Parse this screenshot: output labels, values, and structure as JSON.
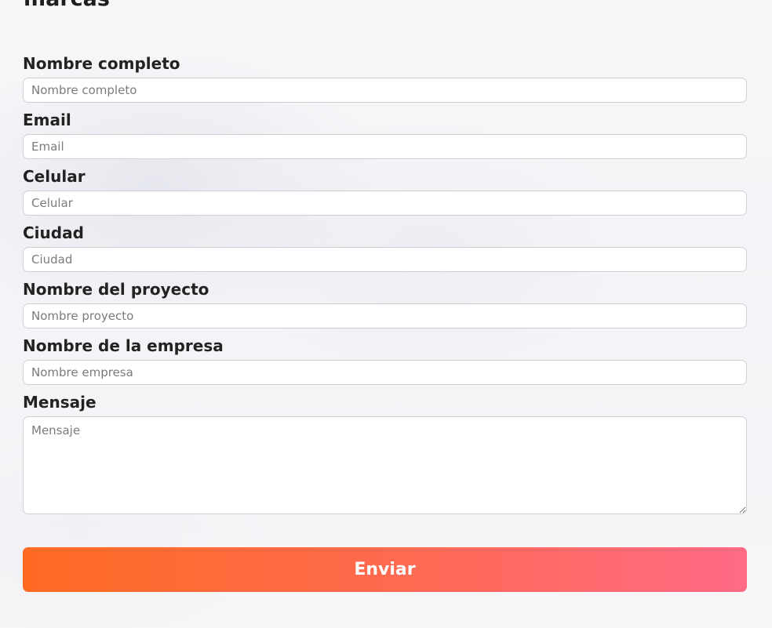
{
  "form": {
    "heading": "marcas",
    "fields": [
      {
        "label": "Nombre completo",
        "placeholder": "Nombre completo",
        "value": ""
      },
      {
        "label": "Email",
        "placeholder": "Email",
        "value": ""
      },
      {
        "label": "Celular",
        "placeholder": "Celular",
        "value": ""
      },
      {
        "label": "Ciudad",
        "placeholder": "Ciudad",
        "value": ""
      },
      {
        "label": "Nombre del proyecto",
        "placeholder": "Nombre proyecto",
        "value": ""
      },
      {
        "label": "Nombre de la empresa",
        "placeholder": "Nombre empresa",
        "value": ""
      }
    ],
    "message": {
      "label": "Mensaje",
      "placeholder": "Mensaje",
      "value": ""
    },
    "submit_label": "Enviar"
  },
  "colors": {
    "button_gradient_start": "#ff6a22",
    "button_gradient_end": "#ff6a86",
    "label_text": "#222222",
    "input_border": "#cfd1d6"
  }
}
